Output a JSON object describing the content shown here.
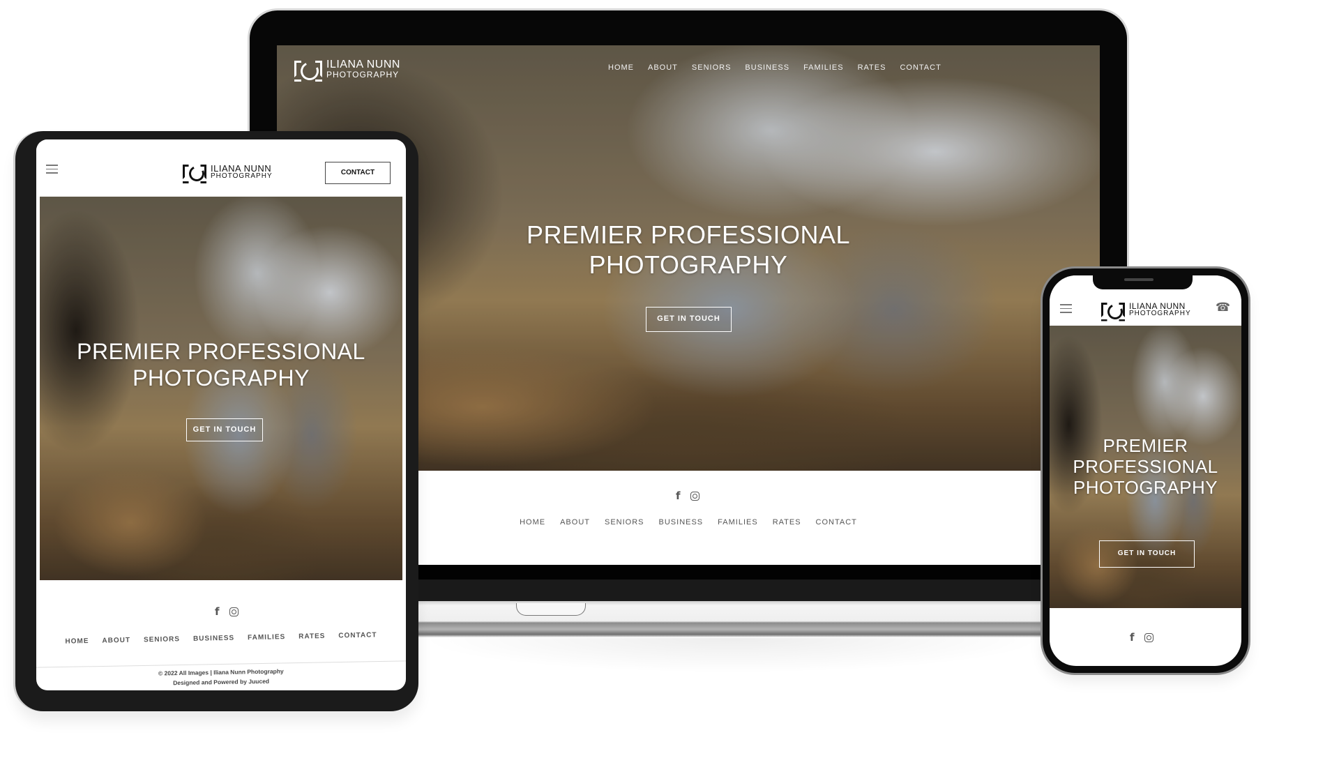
{
  "brand": {
    "name_line1": "ILIANA NUNN",
    "name_line2": "PHOTOGRAPHY"
  },
  "hero": {
    "title": "PREMIER PROFESSIONAL PHOTOGRAPHY",
    "title_line1": "PREMIER PROFESSIONAL",
    "title_line2": "PHOTOGRAPHY",
    "phone_lines": [
      "PREMIER",
      "PROFESSIONAL",
      "PHOTOGRAPHY"
    ],
    "cta_label": "GET IN TOUCH"
  },
  "nav": {
    "items": [
      "HOME",
      "ABOUT",
      "SENIORS",
      "BUSINESS",
      "FAMILIES",
      "RATES",
      "CONTACT"
    ]
  },
  "tablet": {
    "contact_button": "CONTACT",
    "copyright": "© 2022 All Images | Iliana Nunn Photography",
    "credit": "Designed and Powered by Juuced"
  },
  "icons": {
    "facebook": "f",
    "instagram": "instagram-icon",
    "phone": "☎",
    "menu": "hamburger-icon"
  }
}
